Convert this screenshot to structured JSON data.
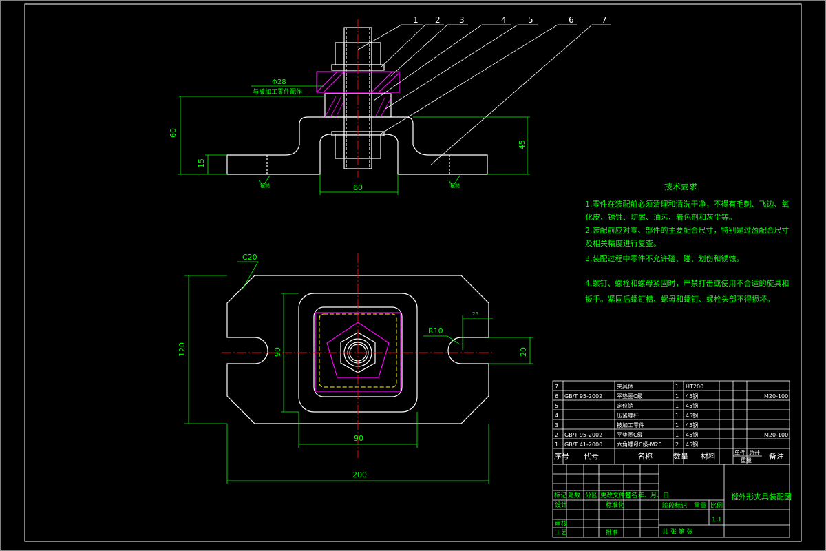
{
  "drawing": {
    "colors": {
      "background": "#000000",
      "outline": "#ffffff",
      "dimension": "#00ff00",
      "centerline": "#ff0000",
      "hatch": "#ff00ff",
      "hidden": "#ffff00",
      "leader": "#ffffff"
    },
    "balloons": [
      "1",
      "2",
      "3",
      "4",
      "5",
      "6",
      "7"
    ],
    "front_view": {
      "dim_overall_height": "60",
      "dim_foot_thickness": "15",
      "dim_right_height": "45",
      "dim_bottom_width": "60",
      "dia_label": "Φ28",
      "note_label": "与被加工零件配作",
      "roughness_left": "粗糙",
      "roughness_right": "粗糙"
    },
    "top_view": {
      "chamfer": "C20",
      "radius": "R10",
      "dim_slot_top": "26",
      "dim_left_height": "120",
      "dim_inner_height": "90",
      "dim_inner_width": "90",
      "dim_overall_width": "200",
      "dim_slot_width": "20"
    },
    "tech_requirements": {
      "title": "技术要求",
      "lines": [
        "1.零件在装配前必须清理和清洗干净，不得有毛刺、飞边、氧",
        "化皮、锈蚀、切屑、油污、着色剂和灰尘等。",
        "2.装配前应对零、部件的主要配合尺寸，特别是过盈配合尺寸",
        "及相关精度进行复查。",
        "3.装配过程中零件不允许磕、碰、划伤和锈蚀。",
        "",
        "4.螺钉、螺栓和螺母紧固时，严禁打击或使用不合适的旋具和",
        "扳手。紧固后螺钉槽、螺母和螺钉、螺栓头部不得损坏。"
      ]
    },
    "parts_list": {
      "rows": [
        {
          "no": "7",
          "code": "",
          "name": "夹具体",
          "qty": "1",
          "material": "HT200",
          "note": ""
        },
        {
          "no": "6",
          "code": "GB/T 95-2002",
          "name": "平垫圈C级",
          "qty": "1",
          "material": "45钢",
          "note": "M20-100"
        },
        {
          "no": "5",
          "code": "",
          "name": "定位销",
          "qty": "1",
          "material": "45钢",
          "note": ""
        },
        {
          "no": "4",
          "code": "",
          "name": "压紧螺杆",
          "qty": "1",
          "material": "45钢",
          "note": ""
        },
        {
          "no": "3",
          "code": "",
          "name": "被加工零件",
          "qty": "1",
          "material": "45钢",
          "note": ""
        },
        {
          "no": "2",
          "code": "GB/T 95-2002",
          "name": "平垫圈C级",
          "qty": "1",
          "material": "45钢",
          "note": "M20-100"
        },
        {
          "no": "1",
          "code": "GB/T 41-2000",
          "name": "六角螺母C级-M20",
          "qty": "2",
          "material": "45钢",
          "note": ""
        }
      ],
      "header": {
        "no": "序号",
        "code": "代号",
        "name": "名称",
        "qty": "数量",
        "material": "材料",
        "single": "单件",
        "total": "总计",
        "weight": "重量",
        "note": "备注"
      }
    },
    "title_block": {
      "drawing_title": "镗外形夹具装配图",
      "rev_cells": [
        "标记",
        "处数",
        "分区",
        "更改文件号",
        "签名",
        "年、月、日"
      ],
      "roles": [
        "设计",
        "审核",
        "工艺"
      ],
      "std": "标准化",
      "approve": "批准",
      "stage": "阶段标记",
      "weight": "重量",
      "scale": "比例",
      "scale_value": "1:1",
      "sheets": "共  张  第  张"
    }
  }
}
